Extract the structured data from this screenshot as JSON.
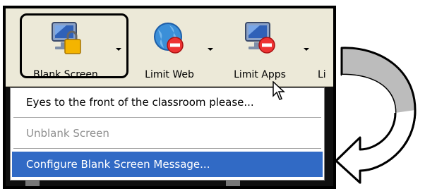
{
  "toolbar": {
    "buttons": [
      {
        "label": "Blank Screen",
        "icon": "monitor-lock-icon"
      },
      {
        "label": "Limit Web",
        "icon": "globe-block-icon"
      },
      {
        "label": "Limit Apps",
        "icon": "monitor-block-icon"
      },
      {
        "label": "Li"
      }
    ]
  },
  "menu": {
    "items": [
      {
        "label": "Eyes to the front of the classroom please...",
        "state": "normal"
      },
      {
        "label": "Unblank Screen",
        "state": "disabled"
      },
      {
        "label": "Configure Blank Screen Message...",
        "state": "hover"
      }
    ]
  },
  "colors": {
    "highlight": "#316ac5",
    "toolbar": "#ece9d8",
    "arrow_fill": "#bcbcbc"
  }
}
